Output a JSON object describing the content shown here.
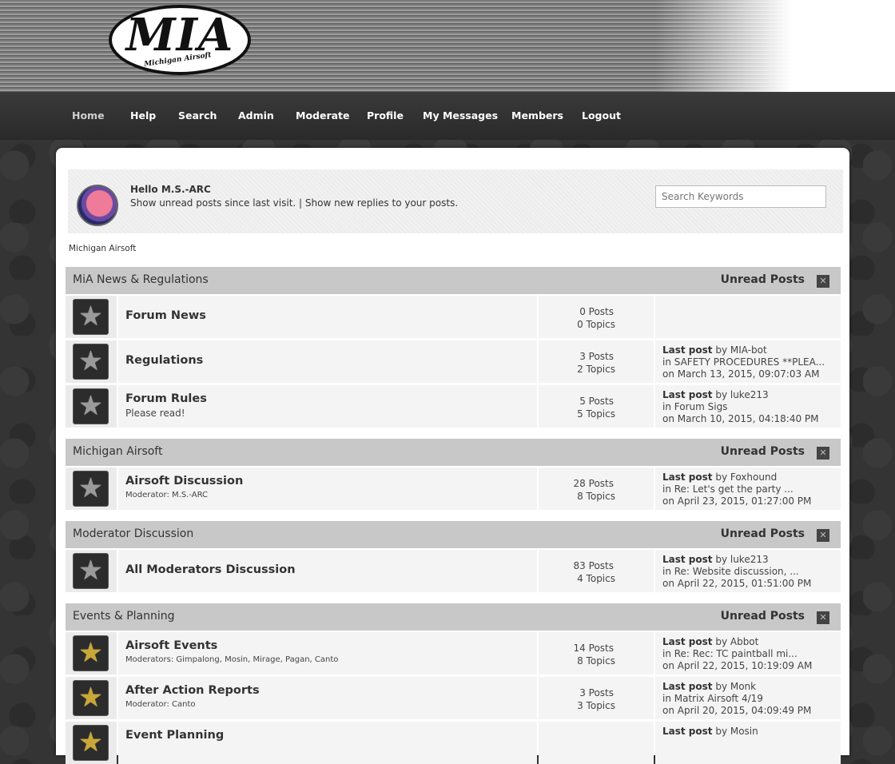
{
  "logo": {
    "text": "MIA",
    "subtitle": "Michigan Airsoft"
  },
  "nav": [
    {
      "label": "Home"
    },
    {
      "label": "Help"
    },
    {
      "label": "Search"
    },
    {
      "label": "Admin"
    },
    {
      "label": "Moderate"
    },
    {
      "label": "Profile"
    },
    {
      "label": "My Messages"
    },
    {
      "label": "Members"
    },
    {
      "label": "Logout"
    }
  ],
  "user": {
    "hello": "Hello M.S.-ARC",
    "unread_link": "Show unread posts since last visit.",
    "separator": " | ",
    "replies_link": "Show new replies to your posts."
  },
  "search": {
    "placeholder": "Search Keywords"
  },
  "breadcrumb": "Michigan Airsoft",
  "categories": [
    {
      "title": "MiA News & Regulations",
      "unread": "Unread Posts",
      "toggle": "✕",
      "boards": [
        {
          "name": "Forum News",
          "desc": "",
          "mods": "",
          "posts": "0 Posts",
          "topics": "0 Topics",
          "star": "silver",
          "last": {
            "label": "",
            "by": "",
            "subject": "",
            "date": ""
          }
        },
        {
          "name": "Regulations",
          "desc": "",
          "mods": "",
          "posts": "3 Posts",
          "topics": "2 Topics",
          "star": "silver",
          "last": {
            "label": "Last post",
            "by": " by MIA-bot",
            "subject": "in SAFETY PROCEDURES **PLEA...",
            "date": "on March 13, 2015, 09:07:03 AM"
          }
        },
        {
          "name": "Forum Rules",
          "desc": "Please read!",
          "mods": "",
          "posts": "5 Posts",
          "topics": "5 Topics",
          "star": "silver",
          "last": {
            "label": "Last post",
            "by": " by luke213",
            "subject": "in Forum Sigs",
            "date": "on March 10, 2015, 04:18:40 PM"
          }
        }
      ]
    },
    {
      "title": "Michigan Airsoft",
      "unread": "Unread Posts",
      "toggle": "✕",
      "boards": [
        {
          "name": "Airsoft Discussion",
          "desc": "",
          "mods": "Moderator: M.S.-ARC",
          "posts": "28 Posts",
          "topics": "8 Topics",
          "star": "silver",
          "last": {
            "label": "Last post",
            "by": " by Foxhound",
            "subject": "in Re: Let's get the party ...",
            "date": "on April 23, 2015, 01:27:00 PM"
          }
        }
      ]
    },
    {
      "title": "Moderator Discussion",
      "unread": "Unread Posts",
      "toggle": "✕",
      "boards": [
        {
          "name": "All Moderators Discussion",
          "desc": "",
          "mods": "",
          "posts": "83 Posts",
          "topics": "4 Topics",
          "star": "silver",
          "last": {
            "label": "Last post",
            "by": " by luke213",
            "subject": "in Re: Website discussion, ...",
            "date": "on April 22, 2015, 01:51:00 PM"
          }
        }
      ]
    },
    {
      "title": "Events & Planning",
      "unread": "Unread Posts",
      "toggle": "✕",
      "boards": [
        {
          "name": "Airsoft Events",
          "desc": "",
          "mods": "Moderators: Gimpalong, Mosin, Mirage, Pagan, Canto",
          "posts": "14 Posts",
          "topics": "8 Topics",
          "star": "gold",
          "last": {
            "label": "Last post",
            "by": " by Abbot",
            "subject": "in Re: Rec: TC paintball mi...",
            "date": "on April 22, 2015, 10:19:09 AM"
          }
        },
        {
          "name": "After Action Reports",
          "desc": "",
          "mods": "Moderator: Canto",
          "posts": "3 Posts",
          "topics": "3 Topics",
          "star": "gold",
          "last": {
            "label": "Last post",
            "by": " by Monk",
            "subject": "in Matrix Airsoft 4/19",
            "date": "on April 20, 2015, 04:09:49 PM"
          }
        },
        {
          "name": "Event Planning",
          "desc": "",
          "mods": "",
          "posts": "",
          "topics": "",
          "star": "gold",
          "last": {
            "label": "Last post",
            "by": " by Mosin",
            "subject": "",
            "date": ""
          }
        }
      ]
    }
  ],
  "colors": {
    "category_bar": "#c8c8c8",
    "nav_bg": "#333333",
    "row_bg": "#f4f4f4"
  }
}
